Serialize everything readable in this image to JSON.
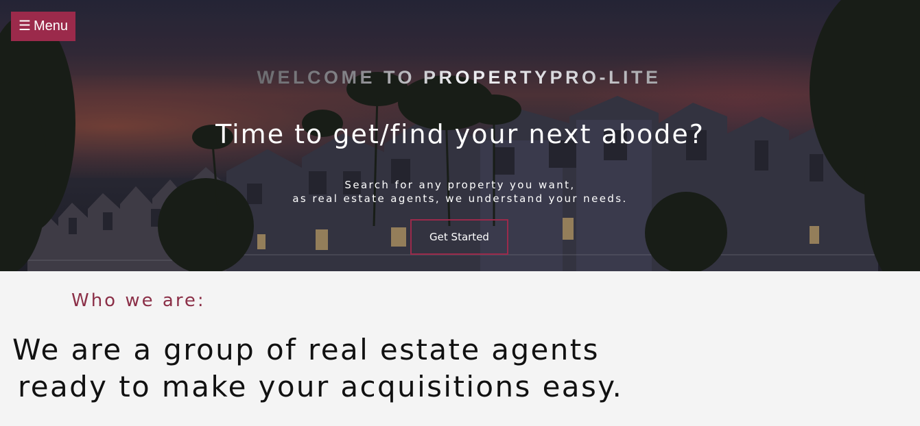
{
  "nav": {
    "menu_icon": "☰",
    "menu_label": "Menu"
  },
  "hero": {
    "welcome": "WELCOME TO PROPERTYPRO-LITE",
    "headline": "Time to get/find your next abode?",
    "sub_line1": "Search for any property you want,",
    "sub_line2": "as real estate agents, we understand your needs.",
    "cta_label": "Get Started"
  },
  "about": {
    "heading": "Who we are:",
    "statement_line1": "We are a group of real estate agents",
    "statement_line2": "ready to make your acquisitions easy."
  },
  "colors": {
    "accent": "#9b2a4b",
    "heading_accent": "#8b2f47",
    "background": "#f4f4f4"
  }
}
